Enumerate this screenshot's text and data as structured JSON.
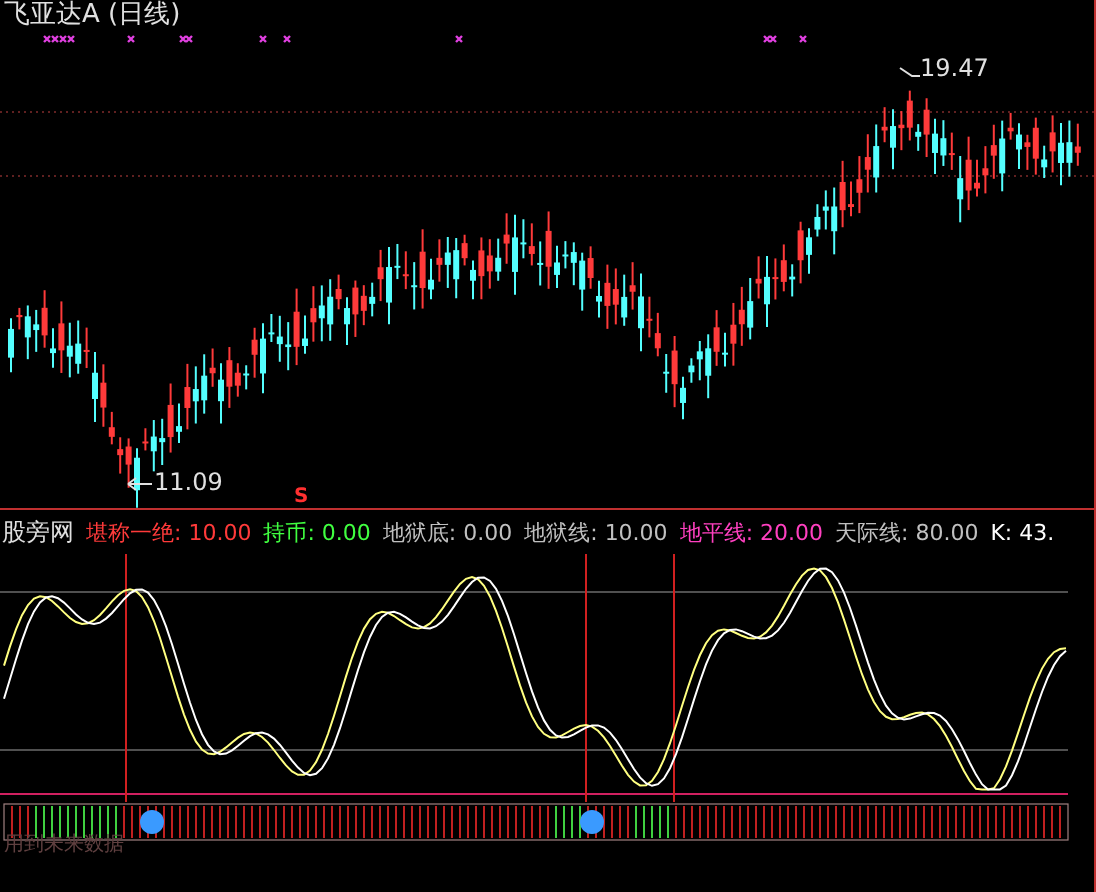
{
  "title": "飞亚达A (日线)",
  "main_chart": {
    "high_label": "19.47",
    "low_label": "11.09",
    "signal_mark": "S"
  },
  "indicator": {
    "name": "股旁网",
    "values": [
      {
        "label": "堪称一绝:",
        "value": "10.00",
        "color": "#ff3a3a"
      },
      {
        "label": "持币:",
        "value": "0.00",
        "color": "#40ff40"
      },
      {
        "label": "地狱底:",
        "value": "0.00",
        "color": "#c0c0c0"
      },
      {
        "label": "地狱线:",
        "value": "10.00",
        "color": "#c0c0c0"
      },
      {
        "label": "地平线:",
        "value": "20.00",
        "color": "#ff40c0"
      },
      {
        "label": "天际线:",
        "value": "80.00",
        "color": "#c0c0c0"
      },
      {
        "label": "K:",
        "value": "43.",
        "color": "#ffffff"
      }
    ]
  },
  "footer_note": "用到未来数据"
}
